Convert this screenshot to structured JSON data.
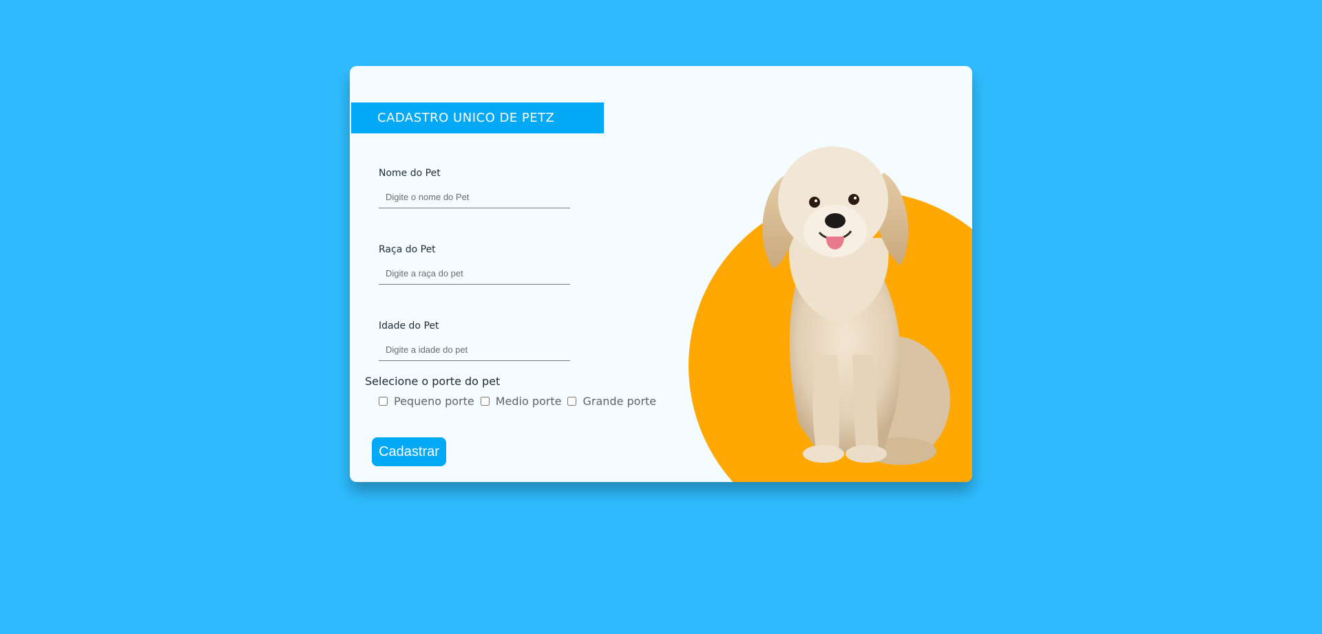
{
  "form": {
    "title": "CADASTRO UNICO DE PETZ",
    "fields": [
      {
        "label": "Nome do Pet",
        "placeholder": "Digite o nome do Pet",
        "value": ""
      },
      {
        "label": "Raça do Pet",
        "placeholder": "Digite a raça do pet",
        "value": ""
      },
      {
        "label": "Idade do Pet",
        "placeholder": "Digite a idade do pet",
        "value": ""
      }
    ],
    "size_title": "Selecione o porte do pet",
    "size_options": [
      {
        "label": "Pequeno porte",
        "checked": false
      },
      {
        "label": "Medio porte",
        "checked": false
      },
      {
        "label": "Grande porte",
        "checked": false
      }
    ],
    "submit_label": "Cadastrar"
  },
  "illustration": {
    "subject": "golden-retriever-dog-photo"
  },
  "colors": {
    "page_background": "#2fbcff",
    "card_background": "#f5fcff",
    "accent_blue": "#03a9f4",
    "accent_orange": "#ffa804"
  }
}
